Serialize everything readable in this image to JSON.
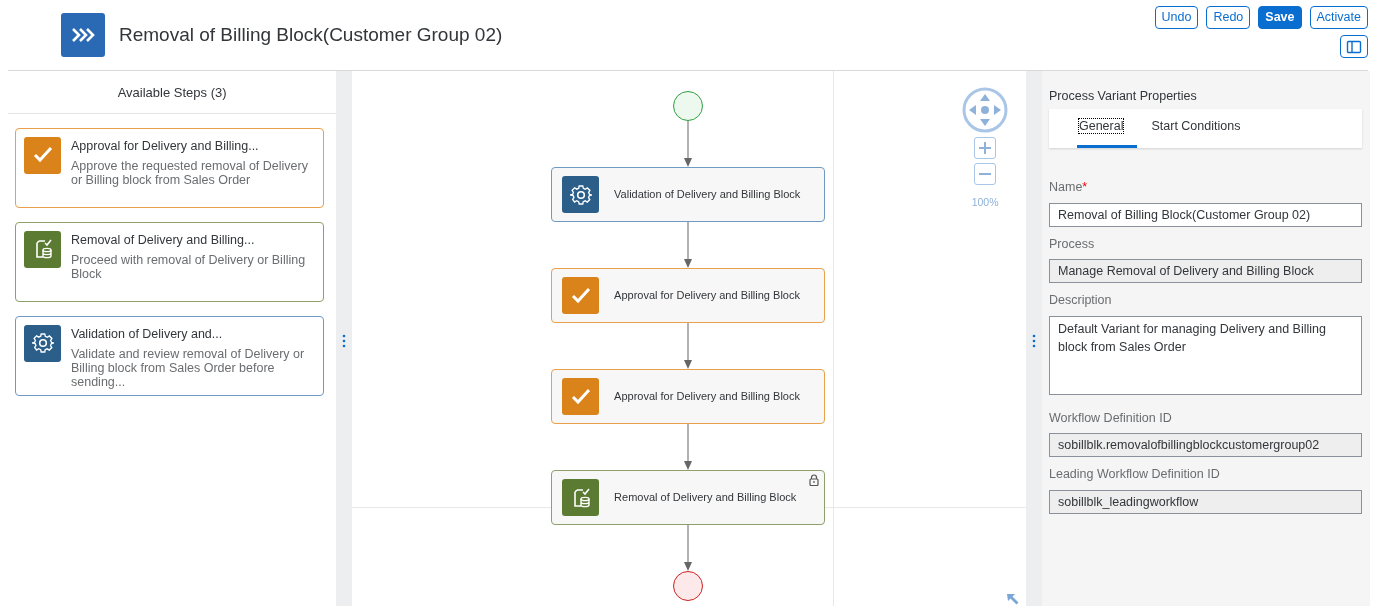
{
  "header": {
    "title": "Removal of Billing Block(Customer Group 02)",
    "buttons": [
      {
        "label": "Undo",
        "emphasized": false
      },
      {
        "label": "Redo",
        "emphasized": false
      },
      {
        "label": "Save",
        "emphasized": true
      },
      {
        "label": "Activate",
        "emphasized": false
      }
    ]
  },
  "available_steps": {
    "title": "Available Steps (3)",
    "items": [
      {
        "kind": "approval",
        "title": "Approval for Delivery and Billing...",
        "description": "Approve the requested removal of Delivery or Billing block from Sales Order"
      },
      {
        "kind": "removal",
        "title": "Removal of Delivery and Billing...",
        "description": "Proceed with removal of Delivery or Billing Block"
      },
      {
        "kind": "validation",
        "title": "Validation of Delivery and...",
        "description": "Validate and review removal of Delivery or Billing block from Sales Order before sending..."
      }
    ]
  },
  "canvas": {
    "zoom": "100%",
    "nodes": [
      {
        "kind": "validation",
        "label": "Validation of Delivery and Billing Block",
        "locked": false
      },
      {
        "kind": "approval",
        "label": "Approval for Delivery and Billing Block",
        "locked": false
      },
      {
        "kind": "approval",
        "label": "Approval for Delivery and Billing Block",
        "locked": false
      },
      {
        "kind": "removal",
        "label": "Removal of Delivery and Billing Block",
        "locked": true
      }
    ]
  },
  "properties": {
    "title": "Process Variant Properties",
    "tabs": [
      {
        "label": "General",
        "selected": true
      },
      {
        "label": "Start Conditions",
        "selected": false
      }
    ],
    "fields": [
      {
        "kind": "input",
        "label": "Name",
        "required_marker": "*",
        "value": "Removal of Billing Block(Customer Group 02)",
        "readonly": false
      },
      {
        "kind": "input",
        "label": "Process",
        "value": "Manage Removal of Delivery and Billing Block",
        "readonly": true
      },
      {
        "kind": "textarea",
        "label": "Description",
        "value": "Default Variant for managing Delivery and Billing block from Sales Order",
        "readonly": false
      },
      {
        "kind": "input",
        "label": "Workflow Definition ID",
        "value": "sobillblk.removalofbillingblockcustomergroup02",
        "readonly": true
      },
      {
        "kind": "input",
        "label": "Leading Workflow Definition ID",
        "value": "sobillblk_leadingworkflow",
        "readonly": true
      }
    ]
  }
}
